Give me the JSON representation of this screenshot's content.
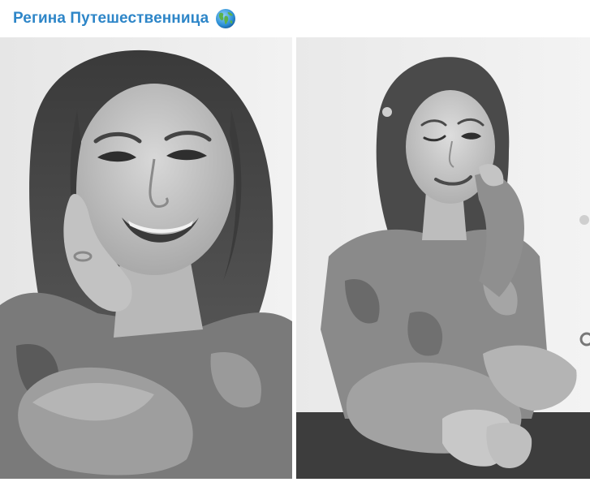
{
  "message": {
    "sender_name": "Регина Путешественница",
    "sender_icon": "globe-icon",
    "colors": {
      "sender_name": "#2e86c8",
      "background": "#ffffff"
    }
  },
  "album": {
    "photos": [
      {
        "name": "photo-left",
        "style": "grayscale portrait"
      },
      {
        "name": "photo-right",
        "style": "grayscale portrait"
      }
    ]
  }
}
